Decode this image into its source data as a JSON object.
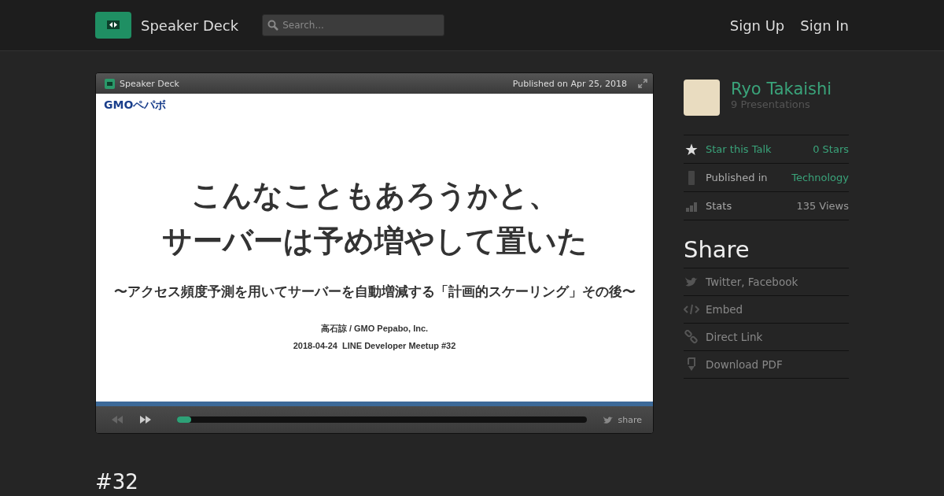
{
  "header": {
    "brand": "Speaker Deck",
    "search": {
      "placeholder": "Search..."
    },
    "nav": [
      "Sign Up",
      "Sign In"
    ]
  },
  "player": {
    "brand": "Speaker Deck",
    "published": "Published on Apr 25, 2018",
    "share": "share",
    "level": 0.015,
    "slide": {
      "logo": "GMOペパボ",
      "title": [
        "こんなこともあろうかと、",
        "サーバーは予め増やして置いた"
      ],
      "subtitle": "〜アクセス頻度予測を用いてサーバーを自動増減する「計画的スケーリング」その後〜",
      "author": "高石諒 / GMO Pepabo, Inc.",
      "event": "2018-04-24  LINE Developer Meetup #32"
    }
  },
  "talk_title": "#32",
  "sidebar": {
    "author": {
      "name": "Ryo Takaishi",
      "count": "9 Presentations"
    },
    "meta": [
      {
        "kind": "star",
        "label": "Star this Talk",
        "value": "0 Stars"
      },
      {
        "kind": "category",
        "label": "Published in",
        "value": "Technology"
      },
      {
        "kind": "stats",
        "label": "Stats",
        "value": "135 Views"
      }
    ],
    "share_title": "Share",
    "share": [
      {
        "kind": "twitter",
        "label": "Twitter, Facebook"
      },
      {
        "kind": "embed",
        "label": "Embed"
      },
      {
        "kind": "link",
        "label": "Direct Link"
      },
      {
        "kind": "pdf",
        "label": "Download PDF"
      }
    ]
  }
}
